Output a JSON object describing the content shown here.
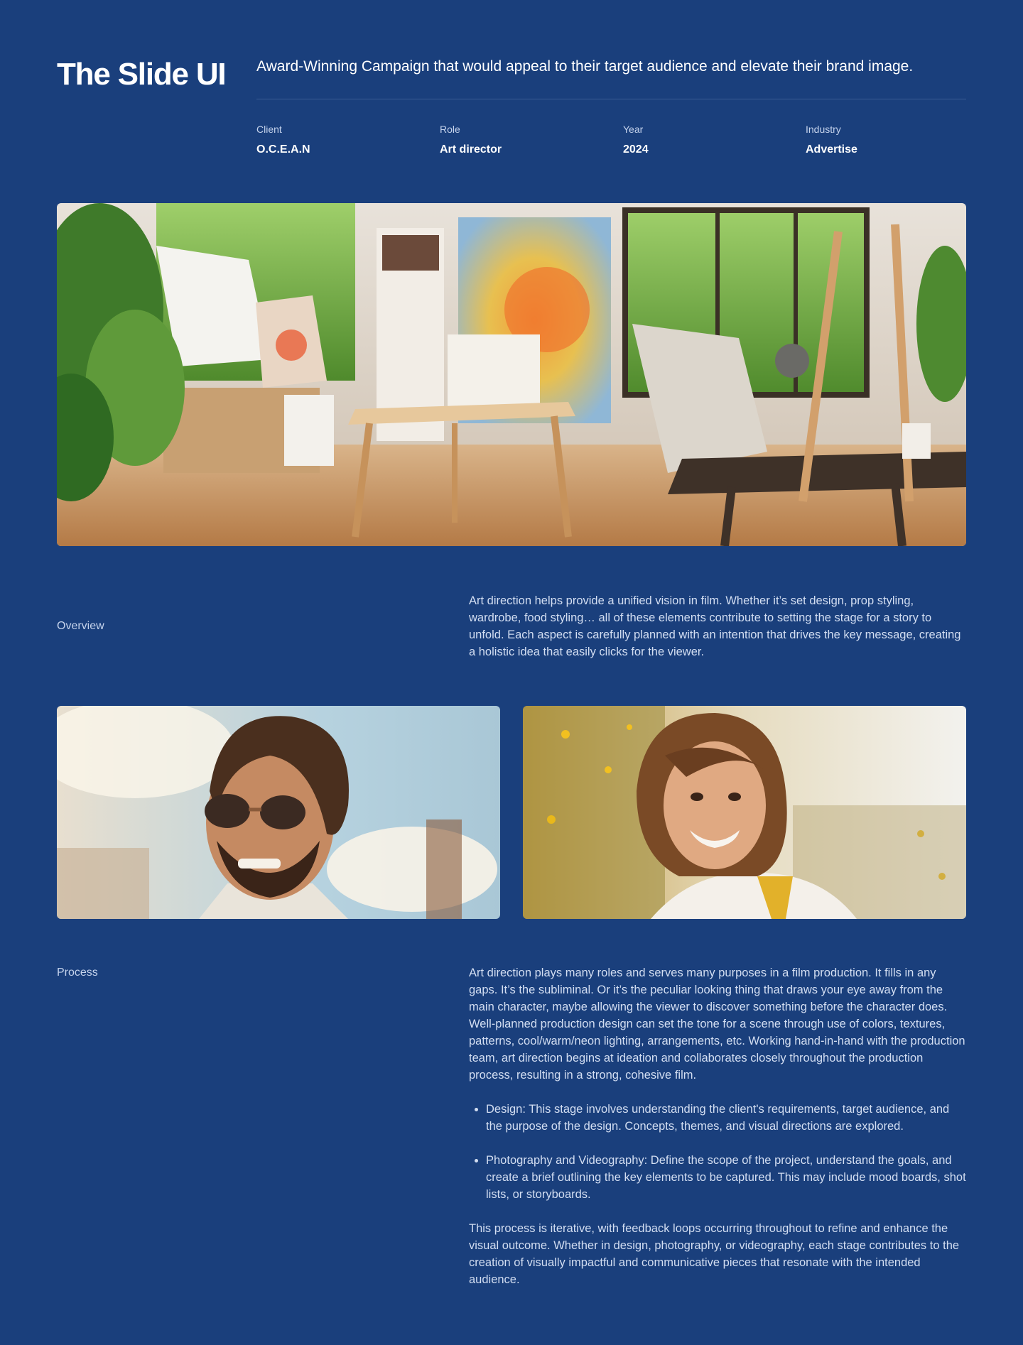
{
  "header": {
    "title": "The Slide UI",
    "tagline": "Award-Winning Campaign that would appeal to their target audience and elevate their brand image."
  },
  "meta": [
    {
      "label": "Client",
      "value": "O.C.E.A.N"
    },
    {
      "label": "Role",
      "value": "Art director"
    },
    {
      "label": "Year",
      "value": "2024"
    },
    {
      "label": "Industry",
      "value": "Advertise"
    }
  ],
  "images": {
    "hero": "art-studio-photo",
    "left": "smiling-man-sunglasses-photo",
    "right": "smiling-woman-field-photo"
  },
  "overview": {
    "label": "Overview",
    "text": "Art direction helps provide a unified vision in film. Whether it’s set design, prop styling, wardrobe, food styling… all of these elements contribute to setting the stage for a story to unfold. Each aspect is carefully planned with an intention that drives the key message, creating a holistic idea that easily clicks for the viewer."
  },
  "process": {
    "label": "Process",
    "intro": "Art direction plays many roles and serves many purposes in a film production. It fills in any gaps. It’s the subliminal. Or it’s the peculiar looking thing that draws your eye away from the main character, maybe allowing the viewer to discover something before the character does. Well-planned production design can set the tone for a scene through use of colors, textures, patterns, cool/warm/neon lighting, arrangements, etc. Working hand-in-hand with the production team, art direction begins at ideation and collaborates closely throughout the production process, resulting in a strong, cohesive film.",
    "bullets": [
      "Design: This stage involves understanding the client's requirements, target audience, and the purpose of the design. Concepts, themes, and visual directions are explored.",
      "Photography and Videography: Define the scope of the project, understand the goals, and create a brief outlining the key elements to be captured. This may include mood boards, shot lists, or storyboards."
    ],
    "outro": "This process is iterative, with feedback loops occurring throughout to refine and enhance the visual outcome. Whether in design, photography, or videography, each stage contributes to the creation of visually impactful and communicative pieces that resonate with the intended audience."
  },
  "colors": {
    "background": "#1a3f7c",
    "divider": "#3a5d95",
    "muted_text": "#c5d3ec"
  }
}
